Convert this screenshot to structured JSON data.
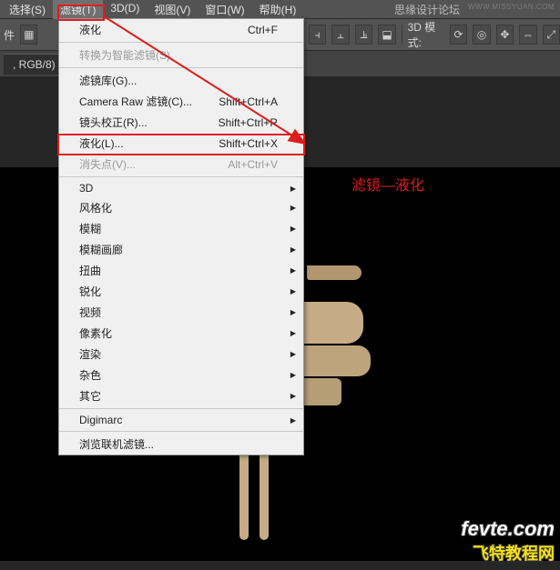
{
  "menubar": {
    "select": "选择(S)",
    "filter": "滤镜(T)",
    "three_d": "3D(D)",
    "view": "视图(V)",
    "window": "窗口(W)",
    "help": "帮助(H)"
  },
  "top_watermark": "思缘设计论坛",
  "top_url": "WWW.MISSYUAN.COM",
  "options": {
    "file_label": "件",
    "mode_label": "3D 模式:"
  },
  "doc_tab": ", RGB/8) *",
  "dropdown": {
    "liquify_last": "液化",
    "liquify_last_shortcut": "Ctrl+F",
    "smart_filter": "转换为智能滤镜(S)",
    "filter_gallery": "滤镜库(G)...",
    "camera_raw": "Camera Raw 滤镜(C)...",
    "camera_raw_shortcut": "Shift+Ctrl+A",
    "lens_correction": "镜头校正(R)...",
    "lens_correction_shortcut": "Shift+Ctrl+R",
    "liquify": "液化(L)...",
    "liquify_shortcut": "Shift+Ctrl+X",
    "vanishing_point": "消失点(V)...",
    "vanishing_point_shortcut": "Alt+Ctrl+V",
    "sub_3d": "3D",
    "stylize": "风格化",
    "blur": "模糊",
    "blur_gallery": "模糊画廊",
    "distort": "扭曲",
    "sharpen": "锐化",
    "video": "视频",
    "pixelate": "像素化",
    "render": "渲染",
    "noise": "杂色",
    "other": "其它",
    "digimarc": "Digimarc",
    "browse_online": "浏览联机滤镜..."
  },
  "annotation": "滤镜—液化",
  "logo": {
    "main": "fevte.com",
    "sub": "飞特教程网"
  }
}
